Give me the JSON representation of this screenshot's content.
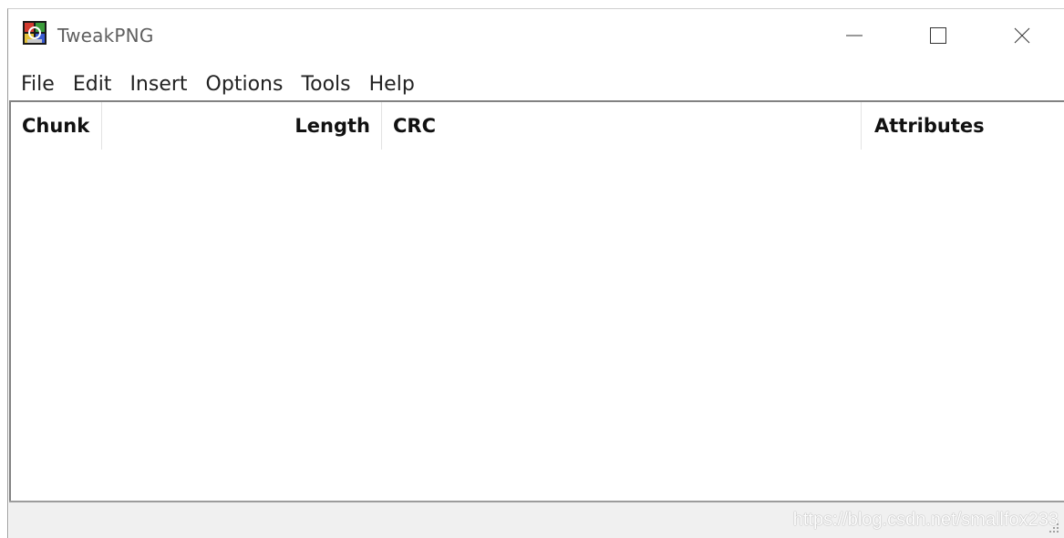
{
  "window": {
    "title": "TweakPNG",
    "controls": {
      "minimize_icon": "minimize-icon",
      "maximize_icon": "maximize-icon",
      "close_icon": "close-icon"
    }
  },
  "menu": {
    "items": [
      "File",
      "Edit",
      "Insert",
      "Options",
      "Tools",
      "Help"
    ]
  },
  "list": {
    "columns": [
      "Chunk",
      "Length",
      "CRC",
      "Attributes"
    ],
    "rows": []
  },
  "statusbar": {
    "text": ""
  },
  "watermark": {
    "text": "https://blog.csdn.net/smallfox233"
  },
  "colors": {
    "title_text": "#5f5f5f",
    "status_bg": "#f0f0f0",
    "border": "#828282"
  }
}
